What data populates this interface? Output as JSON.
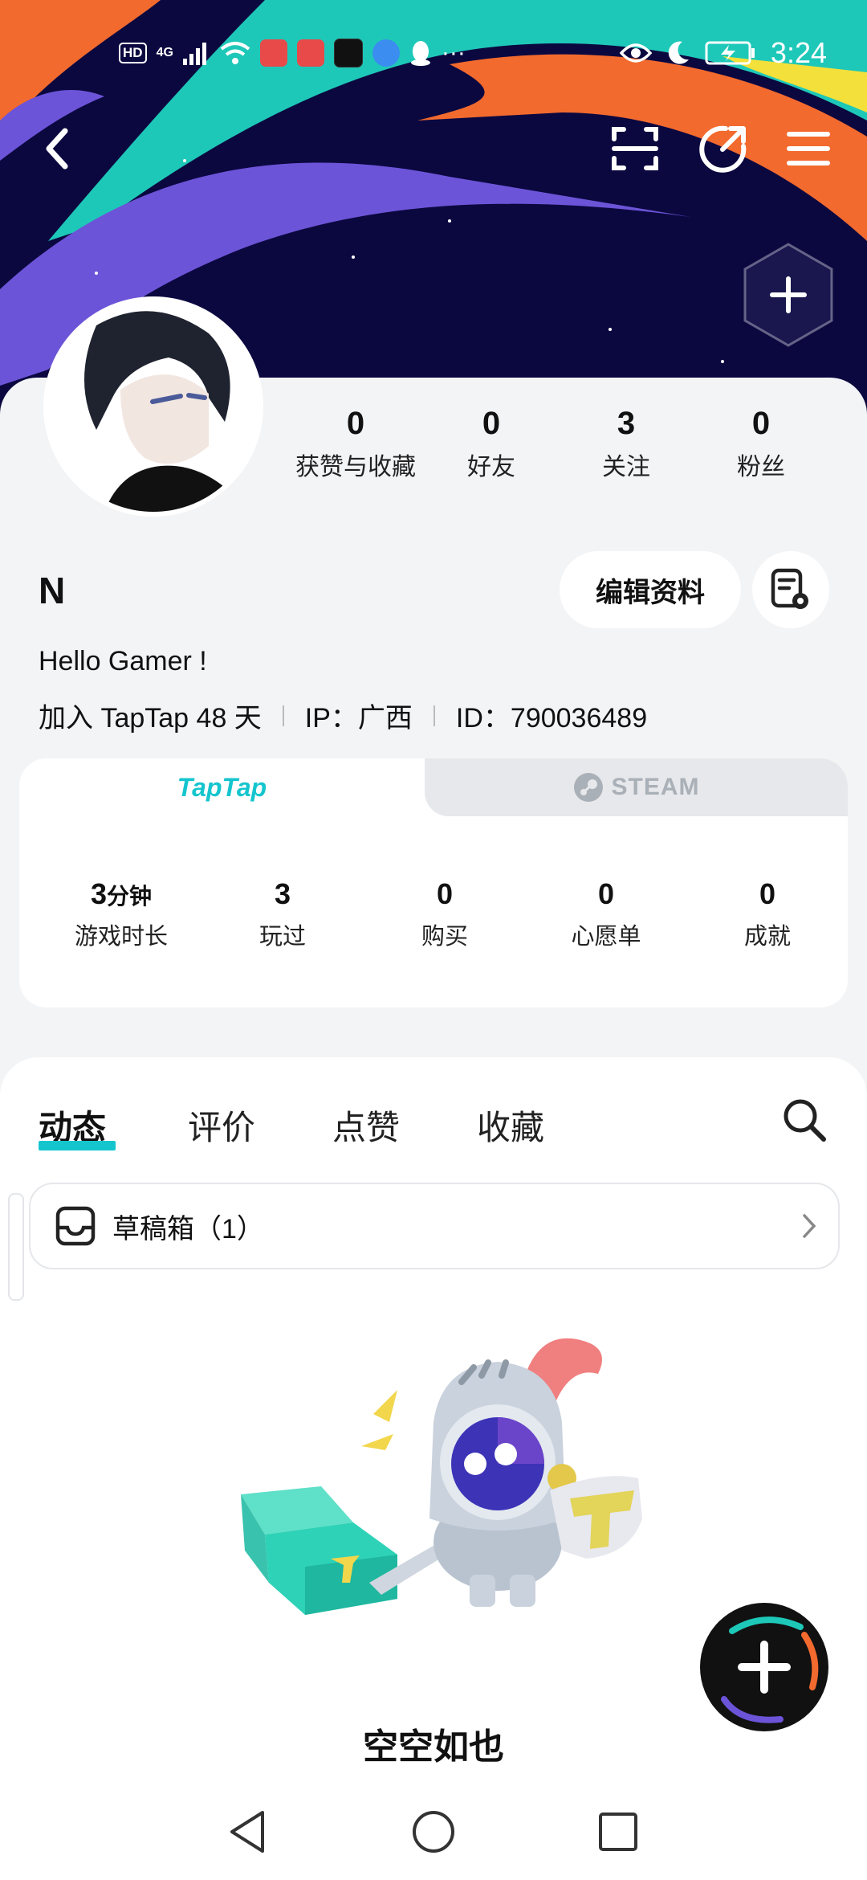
{
  "status_bar": {
    "left_badge": "HD",
    "network": "4G",
    "more": "···",
    "time": "3:24"
  },
  "header": {
    "back_icon": "back-arrow-icon",
    "scan_icon": "scan-icon",
    "share_icon": "share-icon",
    "menu_icon": "menu-icon",
    "add_icon": "plus-icon"
  },
  "profile": {
    "username": "N",
    "bio": "Hello Gamer !",
    "joined": "加入 TapTap 48 天",
    "ip": "IP：广西",
    "id": "ID：790036489",
    "edit_label": "编辑资料",
    "stats": [
      {
        "value": "0",
        "label": "获赞与收藏"
      },
      {
        "value": "0",
        "label": "好友"
      },
      {
        "value": "3",
        "label": "关注"
      },
      {
        "value": "0",
        "label": "粉丝"
      }
    ]
  },
  "platform_card": {
    "tab_taptap": "TapTap",
    "tab_steam": "STEAM",
    "stats": [
      {
        "value": "3",
        "unit": "分钟",
        "label": "游戏时长"
      },
      {
        "value": "3",
        "unit": "",
        "label": "玩过"
      },
      {
        "value": "0",
        "unit": "",
        "label": "购买"
      },
      {
        "value": "0",
        "unit": "",
        "label": "心愿单"
      },
      {
        "value": "0",
        "unit": "",
        "label": "成就"
      }
    ]
  },
  "content": {
    "tabs": [
      "动态",
      "评价",
      "点赞",
      "收藏"
    ],
    "active_tab": "动态",
    "drafts_label": "草稿箱（1）",
    "empty_text": "空空如也"
  },
  "colors": {
    "accent": "#15c5ce",
    "banner_bg": "#0b0840"
  }
}
